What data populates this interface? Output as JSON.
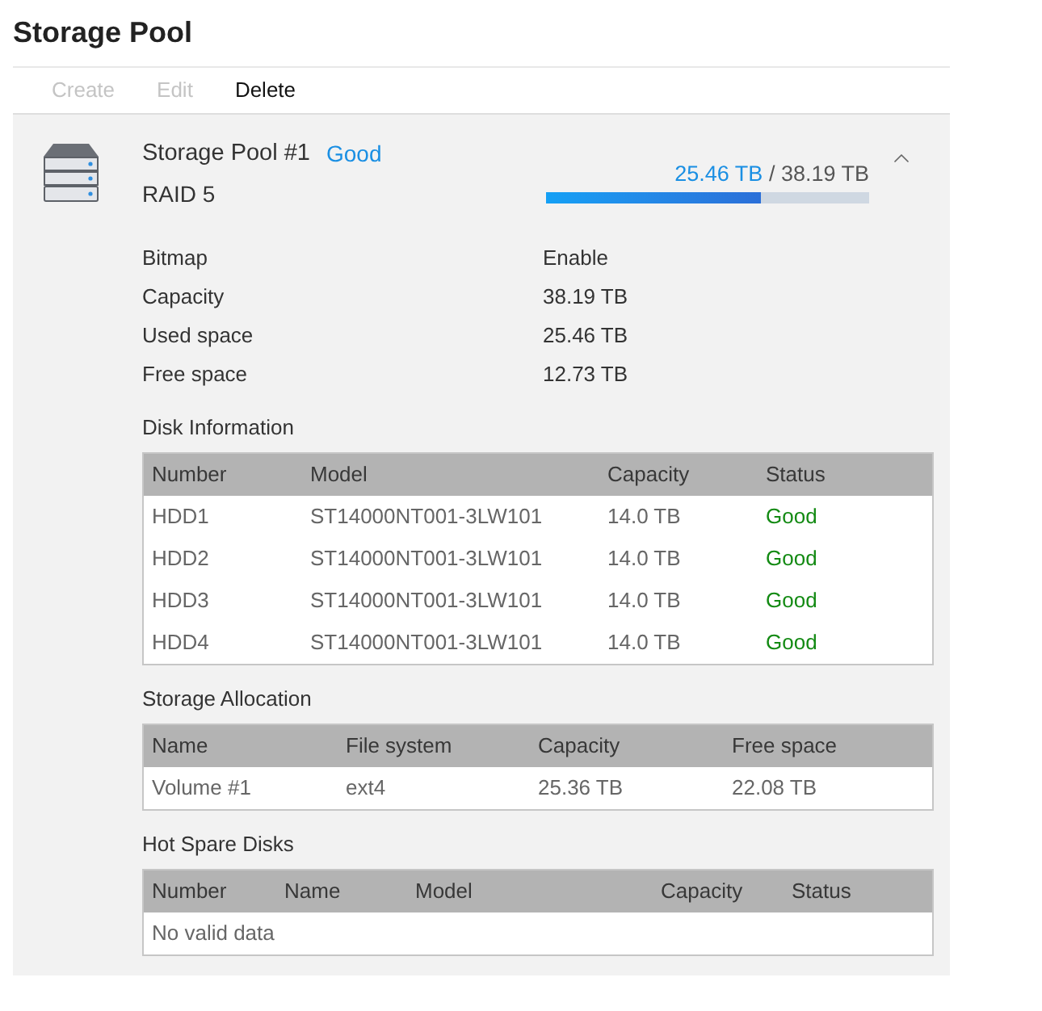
{
  "page_title": "Storage Pool",
  "toolbar": [
    {
      "label": "Create",
      "disabled": true
    },
    {
      "label": "Edit",
      "disabled": true
    },
    {
      "label": "Delete",
      "disabled": false
    }
  ],
  "pool": {
    "name": "Storage Pool #1",
    "status": "Good",
    "raid": "RAID 5",
    "expanded": true,
    "usage": {
      "used": "25.46 TB",
      "separator": "/",
      "total": "38.19 TB",
      "level": 0.667
    }
  },
  "properties": [
    {
      "label": "Bitmap",
      "value": "Enable"
    },
    {
      "label": "Capacity",
      "value": "38.19 TB"
    },
    {
      "label": "Used space",
      "value": "25.46 TB"
    },
    {
      "label": "Free space",
      "value": "12.73 TB"
    }
  ],
  "sections": [
    {
      "title": "Disk Information",
      "kind": "disks",
      "columns": [
        {
          "label": "Number",
          "kind": "text"
        },
        {
          "label": "Model",
          "kind": "text"
        },
        {
          "label": "Capacity",
          "kind": "text"
        },
        {
          "label": "Status",
          "kind": "status"
        }
      ],
      "rows": [
        [
          "HDD1",
          "ST14000NT001-3LW101",
          "14.0 TB",
          "Good"
        ],
        [
          "HDD2",
          "ST14000NT001-3LW101",
          "14.0 TB",
          "Good"
        ],
        [
          "HDD3",
          "ST14000NT001-3LW101",
          "14.0 TB",
          "Good"
        ],
        [
          "HDD4",
          "ST14000NT001-3LW101",
          "14.0 TB",
          "Good"
        ]
      ]
    },
    {
      "title": "Storage Allocation",
      "kind": "volumes",
      "columns": [
        {
          "label": "Name"
        },
        {
          "label": "File system"
        },
        {
          "label": "Capacity"
        },
        {
          "label": "Free space"
        }
      ],
      "rows": [
        [
          "Volume #1",
          "ext4",
          "25.36 TB",
          "22.08 TB"
        ]
      ]
    },
    {
      "title": "Hot Spare Disks",
      "kind": "spares",
      "columns": [
        {
          "label": "Number"
        },
        {
          "label": "Name"
        },
        {
          "label": "Model"
        },
        {
          "label": "Capacity"
        },
        {
          "label": "Status"
        }
      ],
      "empty_text": "No valid data"
    }
  ]
}
